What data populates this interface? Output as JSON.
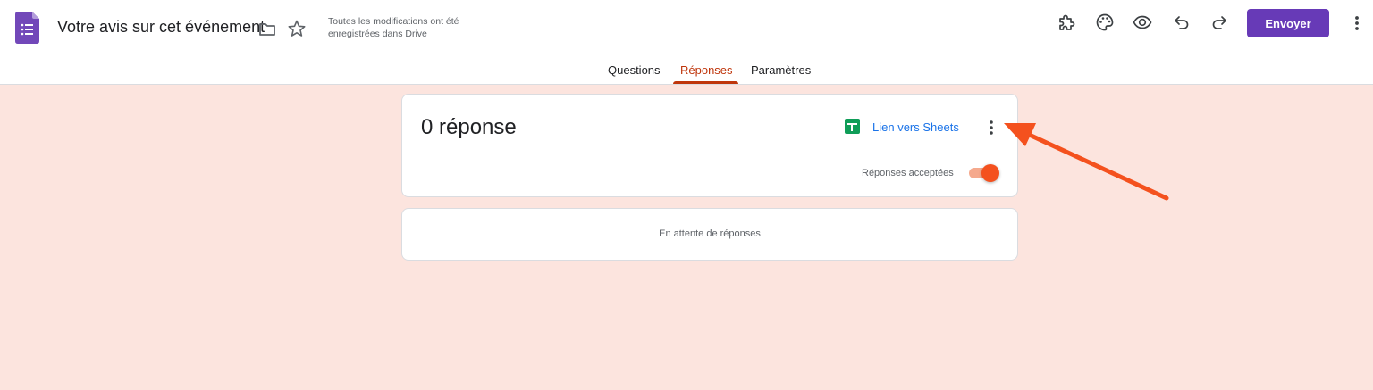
{
  "header": {
    "title": "Votre avis sur cet événement",
    "save_status": "Toutes les modifications ont été enregistrées dans Drive",
    "send_label": "Envoyer",
    "icons": [
      "forms-app-icon",
      "folder-icon",
      "star-icon",
      "addon-icon",
      "palette-icon",
      "eye-icon",
      "undo-icon",
      "redo-icon",
      "more-vert-icon"
    ]
  },
  "tabs": [
    {
      "label": "Questions",
      "active": false
    },
    {
      "label": "Réponses",
      "active": true
    },
    {
      "label": "Paramètres",
      "active": false
    }
  ],
  "summary": {
    "count": "0 réponse",
    "sheets_link": "Lien vers Sheets",
    "accepting_label": "Réponses acceptées",
    "accepting": true
  },
  "empty_state": "En attente de réponses",
  "colors": {
    "accent": "#673ab7",
    "tab_active": "#bf360c",
    "background": "#fce4de",
    "toggle": "#f4511e",
    "link": "#1a73e8",
    "annotation_arrow": "#f4511e"
  }
}
